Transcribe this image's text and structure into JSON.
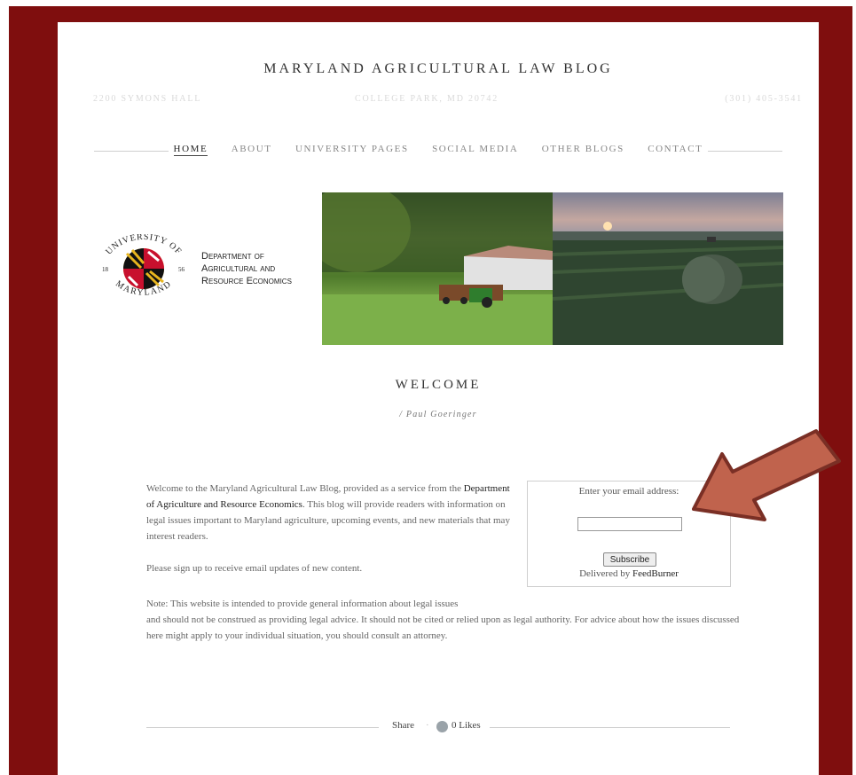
{
  "site": {
    "title": "MARYLAND AGRICULTURAL LAW BLOG",
    "address": "2200 SYMONS HALL",
    "city": "COLLEGE PARK, MD 20742",
    "phone": "(301) 405-3541"
  },
  "nav": {
    "items": [
      {
        "label": "HOME",
        "active": true
      },
      {
        "label": "ABOUT"
      },
      {
        "label": "UNIVERSITY PAGES"
      },
      {
        "label": "SOCIAL MEDIA"
      },
      {
        "label": "OTHER BLOGS"
      },
      {
        "label": "CONTACT"
      }
    ]
  },
  "header": {
    "seal_top": "UNIVERSITY OF",
    "seal_bottom": "MARYLAND",
    "seal_year_left": "18",
    "seal_year_right": "56",
    "dept_line1": "Department of",
    "dept_line2": "Agricultural and",
    "dept_line3": "Resource Economics"
  },
  "post": {
    "title": "WELCOME",
    "byline": "/ Paul Goeringer",
    "p1_before": "Welcome to the Maryland Agricultural Law Blog, provided as a service from the",
    "p1_link": "Department of Agriculture and Resource Economics",
    "p1_after": ".  This blog will provide readers with information on legal issues important to Maryland agriculture, upcoming events, and new materials that may interest readers.",
    "p2": "Please sign up to receive email updates of new content.",
    "note_line1": "Note: This website is intended to provide general information about legal issues",
    "note_line2": " and should not be construed as providing legal advice. It should not be cited or relied upon as legal authority. For advice about how the issues discussed here might apply to your individual situation, you should consult an attorney."
  },
  "subscribe": {
    "label": "Enter your email address:",
    "email_value": "",
    "button": "Subscribe",
    "delivered_by": "Delivered by",
    "provider": "FeedBurner"
  },
  "footer": {
    "share": "Share",
    "likes": "0 Likes"
  },
  "colors": {
    "frame": "#7f0e0e",
    "arrow_fill": "#c0634d",
    "arrow_stroke": "#7a2f25"
  }
}
